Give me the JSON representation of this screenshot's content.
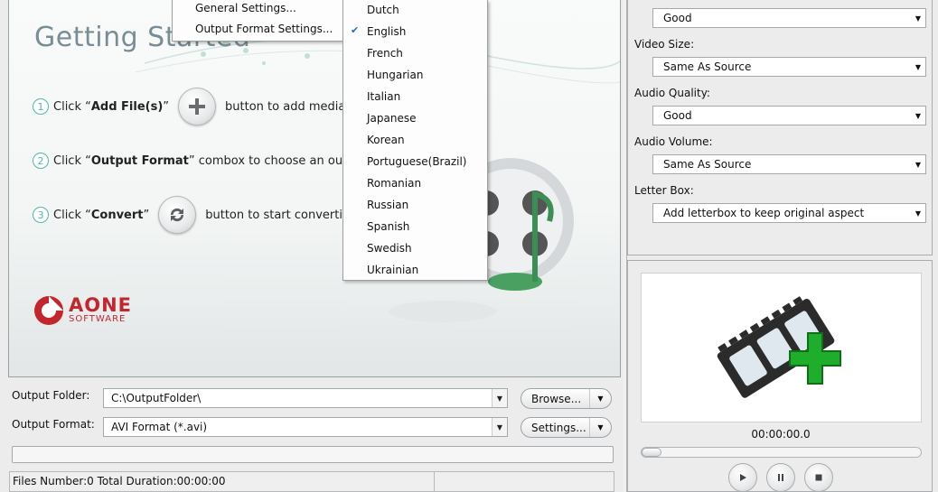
{
  "welcome": {
    "title": "Getting Started",
    "steps": [
      {
        "number": "1",
        "pre": "Click “",
        "strong": "Add File(s)",
        "post": "”",
        "after": "button to add media files"
      },
      {
        "number": "2",
        "pre": "Click “",
        "strong": "Output Format",
        "post": "” combox to choose an output format"
      },
      {
        "number": "3",
        "pre": "Click “",
        "strong": "Convert",
        "post": "”",
        "after": "button to start converting !"
      }
    ],
    "logo": {
      "name": "AONE",
      "sub": "SOFTWARE"
    }
  },
  "output_folder": {
    "label": "Output Folder:",
    "value": "C:\\OutputFolder\\",
    "button": "Browse..."
  },
  "output_format": {
    "label": "Output Format:",
    "value": "AVI Format (*.avi)",
    "button": "Settings..."
  },
  "status": {
    "text": "Files Number:0   Total Duration:00:00:00"
  },
  "settings_panel": {
    "rows": [
      {
        "label": "",
        "value": "Good"
      },
      {
        "label": "Video Size:",
        "value": "Same As Source"
      },
      {
        "label": "Audio Quality:",
        "value": "Good"
      },
      {
        "label": "Audio Volume:",
        "value": "Same As Source"
      },
      {
        "label": "Letter Box:",
        "value": "Add letterbox to keep original aspect"
      }
    ]
  },
  "preview": {
    "time": "00:00:00.0",
    "seek_fraction": 0
  },
  "settings_menu": {
    "items": [
      "General Settings...",
      "Output Format Settings..."
    ]
  },
  "language_menu": {
    "items": [
      "Dutch",
      "English",
      "French",
      "Hungarian",
      "Italian",
      "Japanese",
      "Korean",
      "Portuguese(Brazil)",
      "Romanian",
      "Russian",
      "Spanish",
      "Swedish",
      "Ukrainian"
    ],
    "selected": "English"
  },
  "colors": {
    "accent": "#4fb7a8",
    "logo": "#c3262d",
    "plus_green": "#1fae2c"
  }
}
